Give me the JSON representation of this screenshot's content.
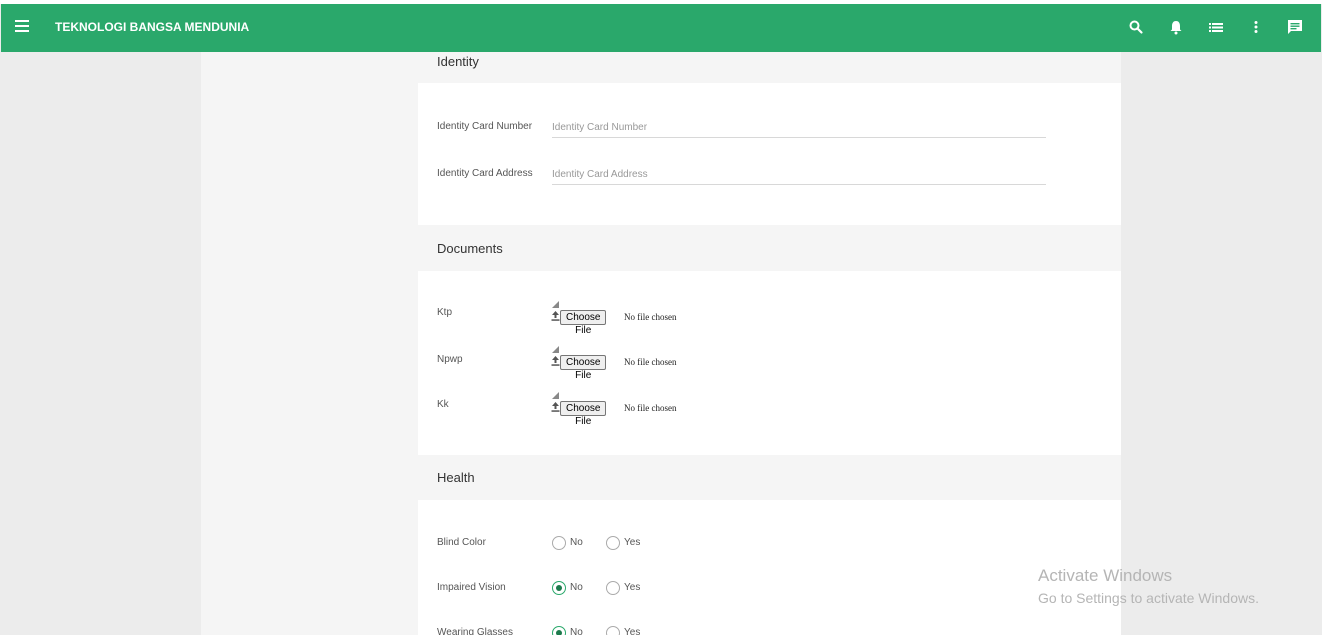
{
  "app": {
    "brand": "TEKNOLOGI BANGSA MENDUNIA"
  },
  "topbar": {
    "icons": [
      "menu-icon",
      "search-icon",
      "bell-icon",
      "list-icon",
      "more-vert-icon",
      "chat-icon"
    ]
  },
  "identity": {
    "title": "Identity",
    "fields": [
      {
        "label": "Identity Card Number",
        "placeholder": "Identity Card Number",
        "value": ""
      },
      {
        "label": "Identity Card Address",
        "placeholder": "Identity Card Address",
        "value": ""
      }
    ]
  },
  "documents": {
    "title": "Documents",
    "files": [
      {
        "label": "Ktp",
        "button": "Choose File",
        "status": "No file chosen"
      },
      {
        "label": "Npwp",
        "button": "Choose File",
        "status": "No file chosen"
      },
      {
        "label": "Kk",
        "button": "Choose File",
        "status": "No file chosen"
      }
    ]
  },
  "health": {
    "title": "Health",
    "questions": [
      {
        "label": "Blind Color",
        "options": [
          "No",
          "Yes"
        ],
        "selected": null
      },
      {
        "label": "Impaired Vision",
        "options": [
          "No",
          "Yes"
        ],
        "selected": "No"
      },
      {
        "label": "Wearing Glasses",
        "options": [
          "No",
          "Yes"
        ],
        "selected": "No"
      }
    ]
  },
  "watermark": {
    "line1": "Activate Windows",
    "line2": "Go to Settings to activate Windows."
  },
  "colors": {
    "primary": "#2aa86b",
    "radio_dot": "#1d7a4c"
  }
}
